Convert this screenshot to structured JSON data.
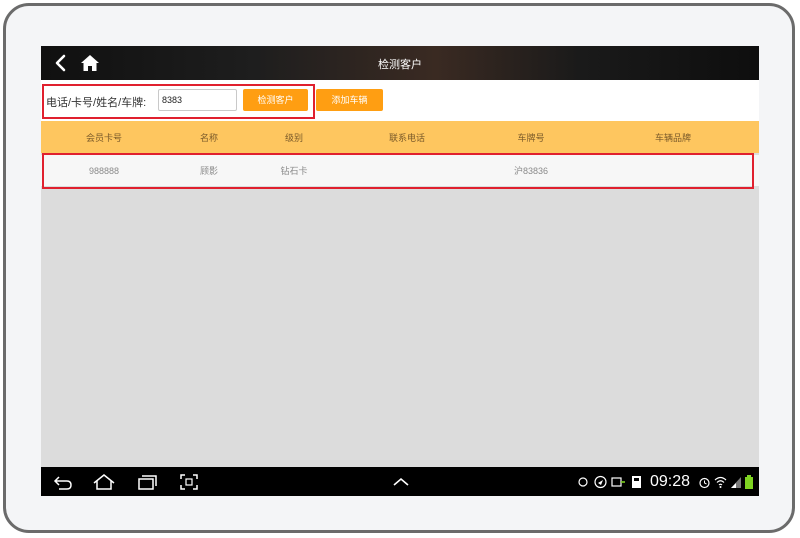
{
  "titlebar": {
    "title": "检测客户",
    "back_icon": "back-arrow-icon",
    "home_icon": "home-icon"
  },
  "search": {
    "label": "电话/卡号/姓名/车牌:",
    "value": "8383",
    "check_button": "检测客户",
    "add_vehicle_button": "添加车辆"
  },
  "table": {
    "headers": [
      "会员卡号",
      "名称",
      "级别",
      "联系电话",
      "车牌号",
      "车辆品牌"
    ],
    "rows": [
      [
        "988888",
        "顾影",
        "钻石卡",
        "",
        "沪83836",
        ""
      ]
    ]
  },
  "statusbar": {
    "time": "09:28"
  },
  "colors": {
    "accent": "#ff9e12",
    "header": "#fec65f",
    "highlight": "#e0202e"
  }
}
